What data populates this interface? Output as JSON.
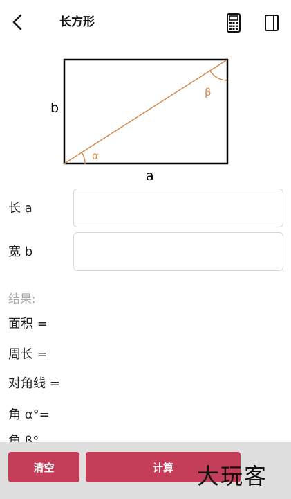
{
  "header": {
    "title": "长方形",
    "back_icon": "chevron-left-icon",
    "calculator_icon": "calculator-icon",
    "panel_icon": "side-panel-icon"
  },
  "diagram": {
    "label_a": "a",
    "label_b": "b",
    "label_alpha": "α",
    "label_beta": "β",
    "diagonal_color": "#d08a4a",
    "outline_color": "#000000"
  },
  "inputs": {
    "length_label": "长 a",
    "length_value": "",
    "width_label": "宽 b",
    "width_value": ""
  },
  "results": {
    "title": "结果:",
    "area": "面积 =",
    "perimeter": "周长 =",
    "diagonal": "对角线 =",
    "angle_alpha": "角 α°=",
    "angle_beta": "角 β°"
  },
  "footer": {
    "clear_label": "清空",
    "calculate_label": "计算",
    "watermark": "大玩客",
    "accent_color": "#c43e5a"
  }
}
